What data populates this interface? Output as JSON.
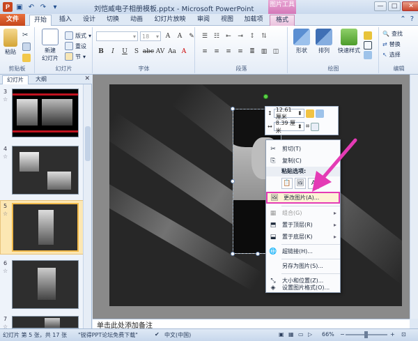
{
  "window": {
    "title": "刘恺威电子相册模板.pptx - Microsoft PowerPoint",
    "context_tab_group": "图片工具",
    "min": "—",
    "max": "□",
    "close": "✕"
  },
  "tabs": {
    "file": "文件",
    "home": "开始",
    "insert": "插入",
    "design": "设计",
    "transitions": "切换",
    "animations": "动画",
    "slideshow": "幻灯片放映",
    "review": "审阅",
    "view": "视图",
    "addins": "加载项",
    "format": "格式"
  },
  "ribbon": {
    "clipboard": {
      "label": "剪贴板",
      "paste": "粘贴"
    },
    "slides": {
      "label": "幻灯片",
      "new_slide": "新建\n幻灯片",
      "layout": "版式",
      "reset": "重设",
      "section": "节"
    },
    "font": {
      "label": "字体",
      "size": "18"
    },
    "paragraph": {
      "label": "段落"
    },
    "drawing": {
      "label": "绘图",
      "shape": "形状",
      "arrange": "排列",
      "quick_styles": "快速样式"
    },
    "editing": {
      "label": "编辑",
      "find": "查找",
      "replace": "替换",
      "select": "选择"
    }
  },
  "panes": {
    "slides_tab": "幻灯片",
    "outline_tab": "大纲",
    "close": "✕"
  },
  "slides": [
    {
      "num": "3"
    },
    {
      "num": "4"
    },
    {
      "num": "5"
    },
    {
      "num": "6"
    },
    {
      "num": "7"
    }
  ],
  "mini_toolbar": {
    "height": "12.61 厘米",
    "width": "8.39 厘米"
  },
  "context_menu": {
    "cut": "剪切(T)",
    "copy": "复制(C)",
    "paste_options": "粘贴选项:",
    "change_picture": "更改图片(A)...",
    "group": "组合(G)",
    "bring_front": "置于顶层(R)",
    "send_back": "置于底层(K)",
    "hyperlink": "超链接(H)...",
    "save_as_picture": "另存为图片(S)...",
    "size_position": "大小和位置(Z)...",
    "format_picture": "设置图片格式(O)..."
  },
  "notes_placeholder": "单击此处添加备注",
  "status": {
    "slide_info": "幻灯片 第 5 张，共 17 张",
    "theme": "\"锐得PPT论坛免费下载\"",
    "language": "中文(中国)",
    "zoom": "66%"
  },
  "colors": {
    "highlight_border": "#e43bb5",
    "arrow": "#e43bb5",
    "file_tab": "#c5461b"
  }
}
